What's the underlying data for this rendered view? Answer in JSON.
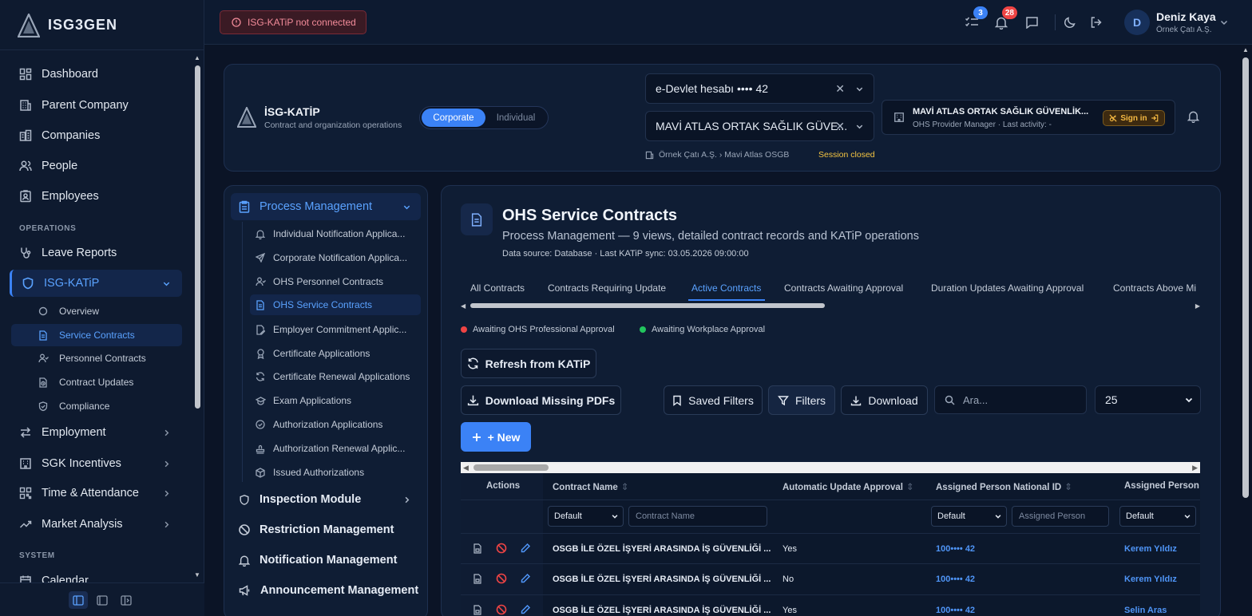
{
  "app": {
    "name": "ISG3GEN"
  },
  "sidebar": {
    "items": [
      {
        "label": "Dashboard",
        "icon": "dashboard-icon"
      },
      {
        "label": "Parent Company",
        "icon": "building-icon"
      },
      {
        "label": "Companies",
        "icon": "buildings-icon"
      },
      {
        "label": "People",
        "icon": "people-icon"
      },
      {
        "label": "Employees",
        "icon": "id-card-icon"
      }
    ],
    "operations_label": "OPERATIONS",
    "operations": [
      {
        "label": "Leave Reports",
        "icon": "stethoscope-icon"
      },
      {
        "label": "ISG-KATiP",
        "icon": "shield-icon"
      }
    ],
    "katip_sub": [
      {
        "label": "Overview"
      },
      {
        "label": "Service Contracts"
      },
      {
        "label": "Personnel Contracts"
      },
      {
        "label": "Contract Updates"
      },
      {
        "label": "Compliance"
      }
    ],
    "more": [
      {
        "label": "Employment"
      },
      {
        "label": "SGK Incentives"
      },
      {
        "label": "Time & Attendance"
      },
      {
        "label": "Market Analysis"
      }
    ],
    "system_label": "SYSTEM",
    "system": [
      {
        "label": "Calendar"
      }
    ]
  },
  "topbar": {
    "warning": "ISG-KATiP not connected",
    "tasks_count": "3",
    "notifications_count": "28",
    "user": {
      "initial": "D",
      "name": "Deniz Kaya",
      "company": "Örnek Çatı A.Ş."
    }
  },
  "katip": {
    "title": "İSG-KATİP",
    "subtitle": "Contract and organization operations",
    "mode_corporate": "Corporate",
    "mode_individual": "Individual",
    "account_select": "e-Devlet hesabı •••• 42",
    "provider_select": "MAVİ ATLAS ORTAK SAĞLIK GÜVE...",
    "breadcrumb": "Örnek Çatı A.Ş. › Mavi Atlas OSGB",
    "session_status": "Session closed",
    "provider_name": "MAVİ ATLAS ORTAK SAĞLIK GÜVENLİK...",
    "provider_role": "OHS Provider Manager · Last activity: -",
    "sign_in": "Sign in"
  },
  "process": {
    "header": "Process Management",
    "items": [
      {
        "label": "Individual Notification Applica..."
      },
      {
        "label": "Corporate Notification Applica..."
      },
      {
        "label": "OHS Personnel Contracts"
      },
      {
        "label": "OHS Service Contracts"
      },
      {
        "label": "Employer Commitment Applic..."
      },
      {
        "label": "Certificate Applications"
      },
      {
        "label": "Certificate Renewal Applications"
      },
      {
        "label": "Exam Applications"
      },
      {
        "label": "Authorization Applications"
      },
      {
        "label": "Authorization Renewal Applic..."
      },
      {
        "label": "Issued Authorizations"
      }
    ],
    "groups": [
      {
        "label": "Inspection Module"
      },
      {
        "label": "Restriction Management"
      },
      {
        "label": "Notification Management"
      },
      {
        "label": "Announcement Management"
      }
    ]
  },
  "page": {
    "title": "OHS Service Contracts",
    "subtitle": "Process Management — 9 views, detailed contract records and KATiP operations",
    "source": "Data source: Database · Last KATiP sync: 03.05.2026 09:00:00",
    "tabs": [
      {
        "label": "All Contracts"
      },
      {
        "label": "Contracts Requiring Update"
      },
      {
        "label": "Active Contracts"
      },
      {
        "label": "Contracts Awaiting Approval"
      },
      {
        "label": "Duration Updates Awaiting Approval"
      },
      {
        "label": "Contracts Above Mi"
      }
    ],
    "legend": [
      {
        "label": "Awaiting OHS Professional Approval",
        "color": "#ef4444"
      },
      {
        "label": "Awaiting Workplace Approval",
        "color": "#22c55e"
      }
    ],
    "buttons": {
      "refresh": "Refresh from KATiP",
      "download_missing": "Download Missing PDFs",
      "saved_filters": "Saved Filters",
      "filters": "Filters",
      "download": "Download",
      "new": "+ New"
    },
    "search_placeholder": "Ara...",
    "per_page": "25"
  },
  "table": {
    "headers": {
      "actions": "Actions",
      "contract_name": "Contract Name",
      "auto_update": "Automatic Update Approval",
      "national_id": "Assigned Person National ID",
      "assigned_person": "Assigned Person"
    },
    "filters": {
      "default": "Default",
      "contract_name_placeholder": "Contract Name",
      "assigned_person_placeholder": "Assigned Person"
    },
    "rows": [
      {
        "contract": "OSGB İLE ÖZEL İŞYERİ ARASINDA İŞ GÜVENLİĞİ ...",
        "auto": "Yes",
        "national_id": "100•••• 42",
        "person": "Kerem Yıldız"
      },
      {
        "contract": "OSGB İLE ÖZEL İŞYERİ ARASINDA İŞ GÜVENLİĞİ ...",
        "auto": "No",
        "national_id": "100•••• 42",
        "person": "Kerem Yıldız"
      },
      {
        "contract": "OSGB İLE ÖZEL İŞYERİ ARASINDA İŞ GÜVENLİĞİ ...",
        "auto": "Yes",
        "national_id": "100•••• 42",
        "person": "Selin Aras"
      }
    ]
  }
}
